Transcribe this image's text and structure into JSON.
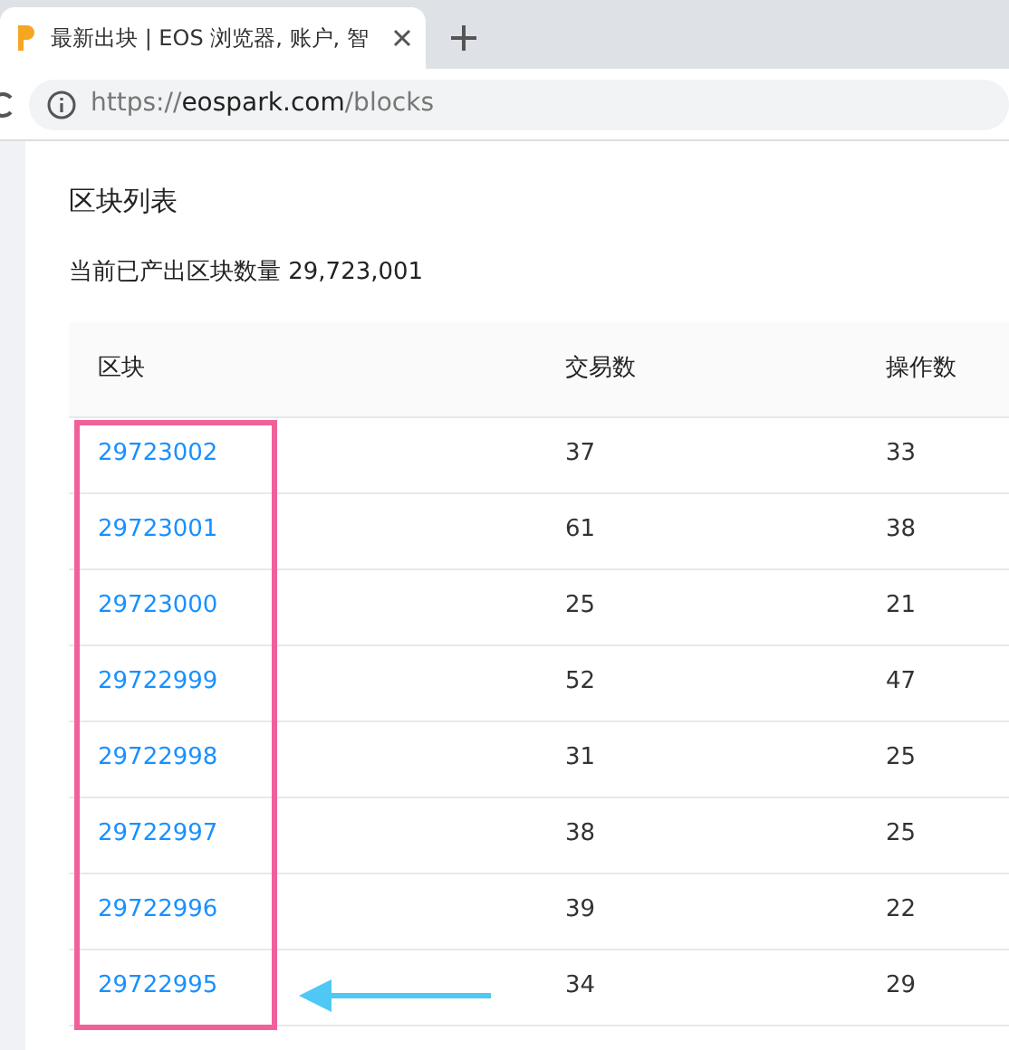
{
  "browser": {
    "tab_title": "最新出块 | EOS 浏览器, 账户, 智",
    "url": {
      "scheme": "https://",
      "host": "eospark.com",
      "path": "/blocks"
    }
  },
  "page": {
    "title": "区块列表",
    "summary": "当前已产出区块数量 29,723,001"
  },
  "table": {
    "columns": [
      "区块",
      "交易数",
      "操作数"
    ],
    "rows": [
      [
        "29723002",
        "37",
        "33"
      ],
      [
        "29723001",
        "61",
        "38"
      ],
      [
        "29723000",
        "25",
        "21"
      ],
      [
        "29722999",
        "52",
        "47"
      ],
      [
        "29722998",
        "31",
        "25"
      ],
      [
        "29722997",
        "38",
        "25"
      ],
      [
        "29722996",
        "39",
        "22"
      ],
      [
        "29722995",
        "34",
        "29"
      ]
    ]
  }
}
